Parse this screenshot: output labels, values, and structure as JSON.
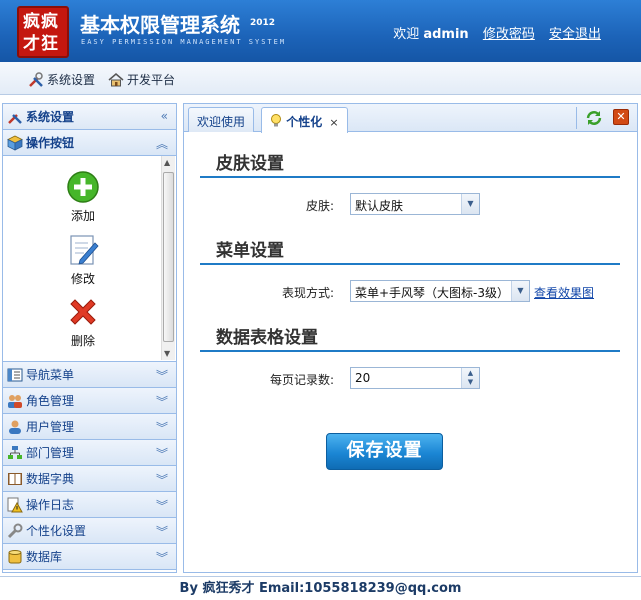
{
  "header": {
    "logo_line1": "疯疯",
    "logo_line2": "才狂",
    "title": "基本权限管理系统",
    "year": "2012",
    "subtitle": "EASY PERMISSION MANAGEMENT SYSTEM",
    "welcome": "欢迎",
    "username": "admin",
    "change_password": "修改密码",
    "logout": "安全退出"
  },
  "toolbar": {
    "system_settings": "系统设置",
    "dev_platform": "开发平台"
  },
  "sidebar": {
    "title": "系统设置",
    "sections": [
      {
        "label": "操作按钮",
        "icon": "cube-icon"
      },
      {
        "label": "导航菜单",
        "icon": "menu-icon"
      },
      {
        "label": "角色管理",
        "icon": "users-icon"
      },
      {
        "label": "用户管理",
        "icon": "user-icon"
      },
      {
        "label": "部门管理",
        "icon": "org-icon"
      },
      {
        "label": "数据字典",
        "icon": "book-icon"
      },
      {
        "label": "操作日志",
        "icon": "warning-icon"
      },
      {
        "label": "个性化设置",
        "icon": "wrench-icon"
      },
      {
        "label": "数据库",
        "icon": "database-icon"
      }
    ],
    "buttons": [
      {
        "label": "添加",
        "icon": "add-icon"
      },
      {
        "label": "修改",
        "icon": "edit-icon"
      },
      {
        "label": "删除",
        "icon": "delete-icon"
      }
    ]
  },
  "tabs": [
    {
      "label": "欢迎使用",
      "active": false
    },
    {
      "label": "个性化",
      "active": true,
      "close": "×"
    }
  ],
  "settings": {
    "skin_section": "皮肤设置",
    "skin_label": "皮肤:",
    "skin_value": "默认皮肤",
    "menu_section": "菜单设置",
    "menu_label": "表现方式:",
    "menu_value": "菜单+手风琴（大图标-3级）",
    "menu_link": "查看效果图",
    "grid_section": "数据表格设置",
    "grid_label": "每页记录数:",
    "grid_value": "20",
    "save_label": "保存设置"
  },
  "footer": {
    "text": "By 疯狂秀才 Email:1055818239@qq.com"
  }
}
